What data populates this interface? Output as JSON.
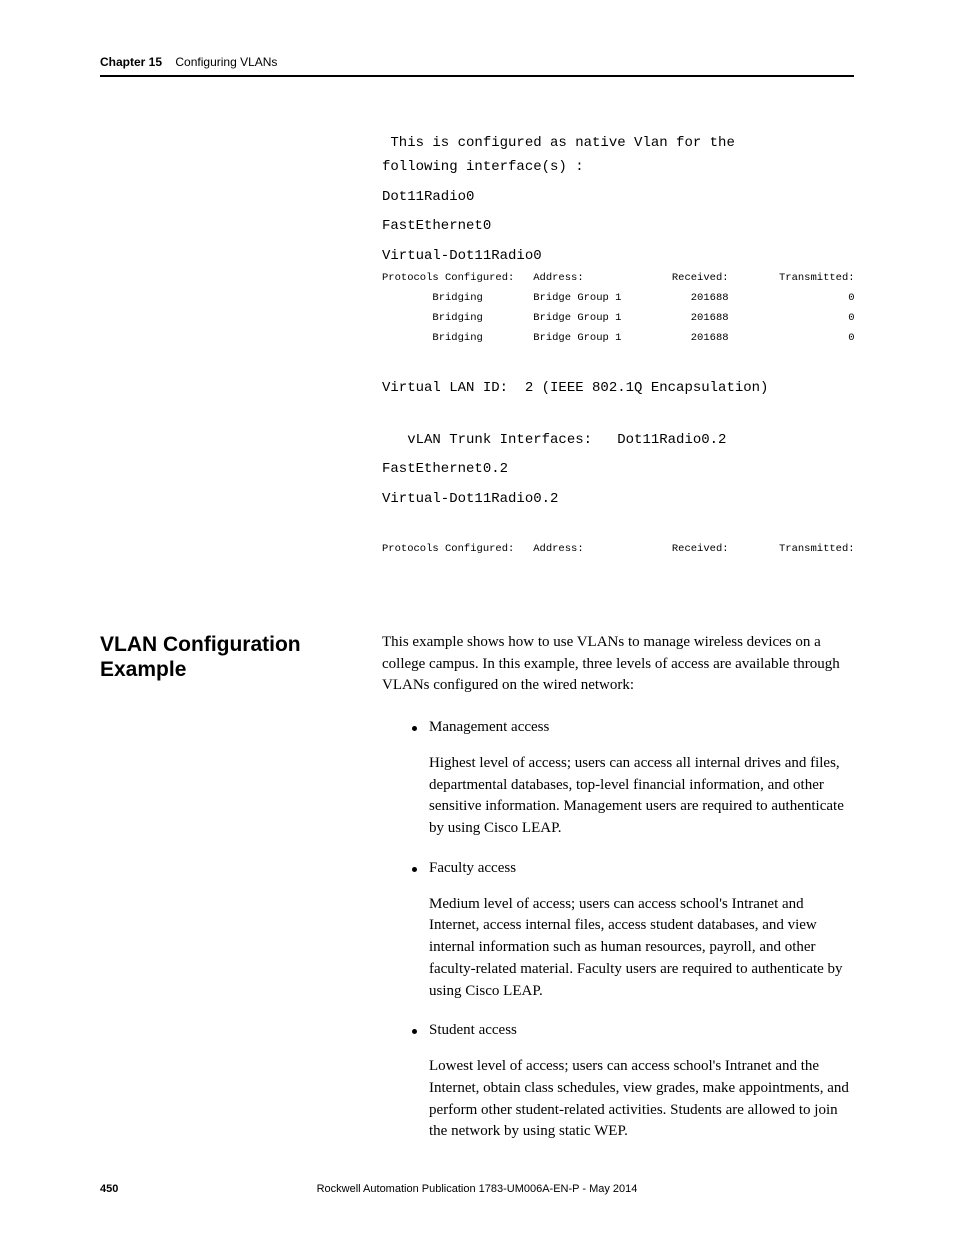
{
  "header": {
    "chapter": "Chapter 15",
    "title": "Configuring VLANs"
  },
  "cli": {
    "line1": " This is configured as native Vlan for the",
    "line2": "following interface(s) :",
    "if1": "Dot11Radio0",
    "if2": "FastEthernet0",
    "if3": "Virtual-Dot11Radio0",
    "table1_header": "Protocols Configured:   Address:              Received:        Transmitted:",
    "table1_row1": "        Bridging        Bridge Group 1           201688                   0",
    "table1_row2": "        Bridging        Bridge Group 1           201688                   0",
    "table1_row3": "        Bridging        Bridge Group 1           201688                   0",
    "vlan2": "Virtual LAN ID:  2 (IEEE 802.1Q Encapsulation)",
    "trunk": "   vLAN Trunk Interfaces:   Dot11Radio0.2",
    "if4": "FastEthernet0.2",
    "if5": "Virtual-Dot11Radio0.2",
    "table2_header": "Protocols Configured:   Address:              Received:        Transmitted:"
  },
  "section": {
    "heading": "VLAN Configuration Example",
    "intro": "This example shows how to use VLANs to manage wireless devices on a college campus. In this example, three levels of access are available through VLANs configured on the wired network:",
    "bullets": [
      {
        "label": "Management access",
        "desc": "Highest level of access; users can access all internal drives and files, departmental databases, top-level financial information, and other sensitive information. Management users are required to authenticate by using Cisco LEAP."
      },
      {
        "label": "Faculty access",
        "desc": "Medium level of access; users can access school's Intranet and Internet, access internal files, access student databases, and view internal information such as human resources, payroll, and other faculty-related material. Faculty users are required to authenticate by using Cisco LEAP."
      },
      {
        "label": "Student access",
        "desc": "Lowest level of access; users can access school's Intranet and the Internet, obtain class schedules, view grades, make appointments, and perform other student-related activities. Students are allowed to join the network by using static WEP."
      }
    ]
  },
  "footer": {
    "page": "450",
    "pub": "Rockwell Automation Publication 1783-UM006A-EN-P - May 2014"
  }
}
